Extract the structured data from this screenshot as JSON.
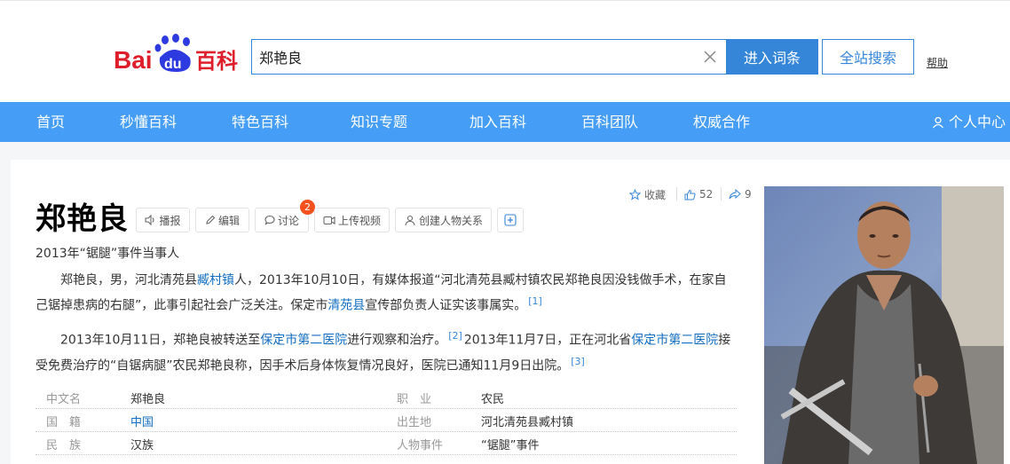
{
  "header": {
    "logo": {
      "part1": "Bai",
      "part2": "du",
      "part3": "百科"
    },
    "search_value": "郑艳良",
    "enter_label": "进入词条",
    "all_label": "全站搜索",
    "help_label": "帮助"
  },
  "nav": {
    "items": [
      "首页",
      "秒懂百科",
      "特色百科",
      "知识专题",
      "加入百科",
      "百科团队",
      "权威合作"
    ],
    "user_label": "个人中心"
  },
  "entry": {
    "title": "郑艳良",
    "subtitle": "2013年“锯腿”事件当事人",
    "tools": {
      "play": "播报",
      "edit": "编辑",
      "discuss": "讨论",
      "discuss_badge": "2",
      "upload": "上传视频",
      "relation": "创建人物关系"
    },
    "meta": {
      "collect": "收藏",
      "likes": "52",
      "shares": "9"
    },
    "para1": {
      "t1": "郑艳良，男，河北清苑县",
      "l1": "臧村镇",
      "t2": "人，2013年10月10日，有媒体报道“河北清苑县臧村镇农民郑艳良因没钱做手术，在家自己锯掉患病的右腿”，此事引起社会广泛关注。保定市",
      "l2": "清苑县",
      "t3": "宣传部负责人证实该事属实。",
      "ref": "[1]"
    },
    "para2": {
      "t1": "2013年10月11日，郑艳良被转送至",
      "l1": "保定市第二医院",
      "t2": "进行观察和治疗。",
      "ref1": "[2]",
      "t3": "2013年11月7日，正在河北省",
      "l2": "保定市第二医院",
      "t4": "接受免费治疗的“自锯病腿”农民郑艳良称，因手术后身体恢复情况良好，医院已通知11月9日出院。",
      "ref2": "[3]"
    },
    "info": [
      {
        "label": "中文名",
        "value": "郑艳良",
        "label2": "职　业",
        "value2": "农民",
        "link": false
      },
      {
        "label": "国　籍",
        "value": "中国",
        "label2": "出生地",
        "value2": "河北清苑县臧村镇",
        "link": true
      },
      {
        "label": "民　族",
        "value": "汉族",
        "label2": "人物事件",
        "value2": "“锯腿”事件",
        "link": false
      }
    ]
  },
  "colors": {
    "brand_blue": "#3586d8",
    "nav_blue": "#459df5",
    "logo_red": "#de1e2a",
    "logo_blue": "#2d3ae0",
    "badge": "#f4511e"
  }
}
